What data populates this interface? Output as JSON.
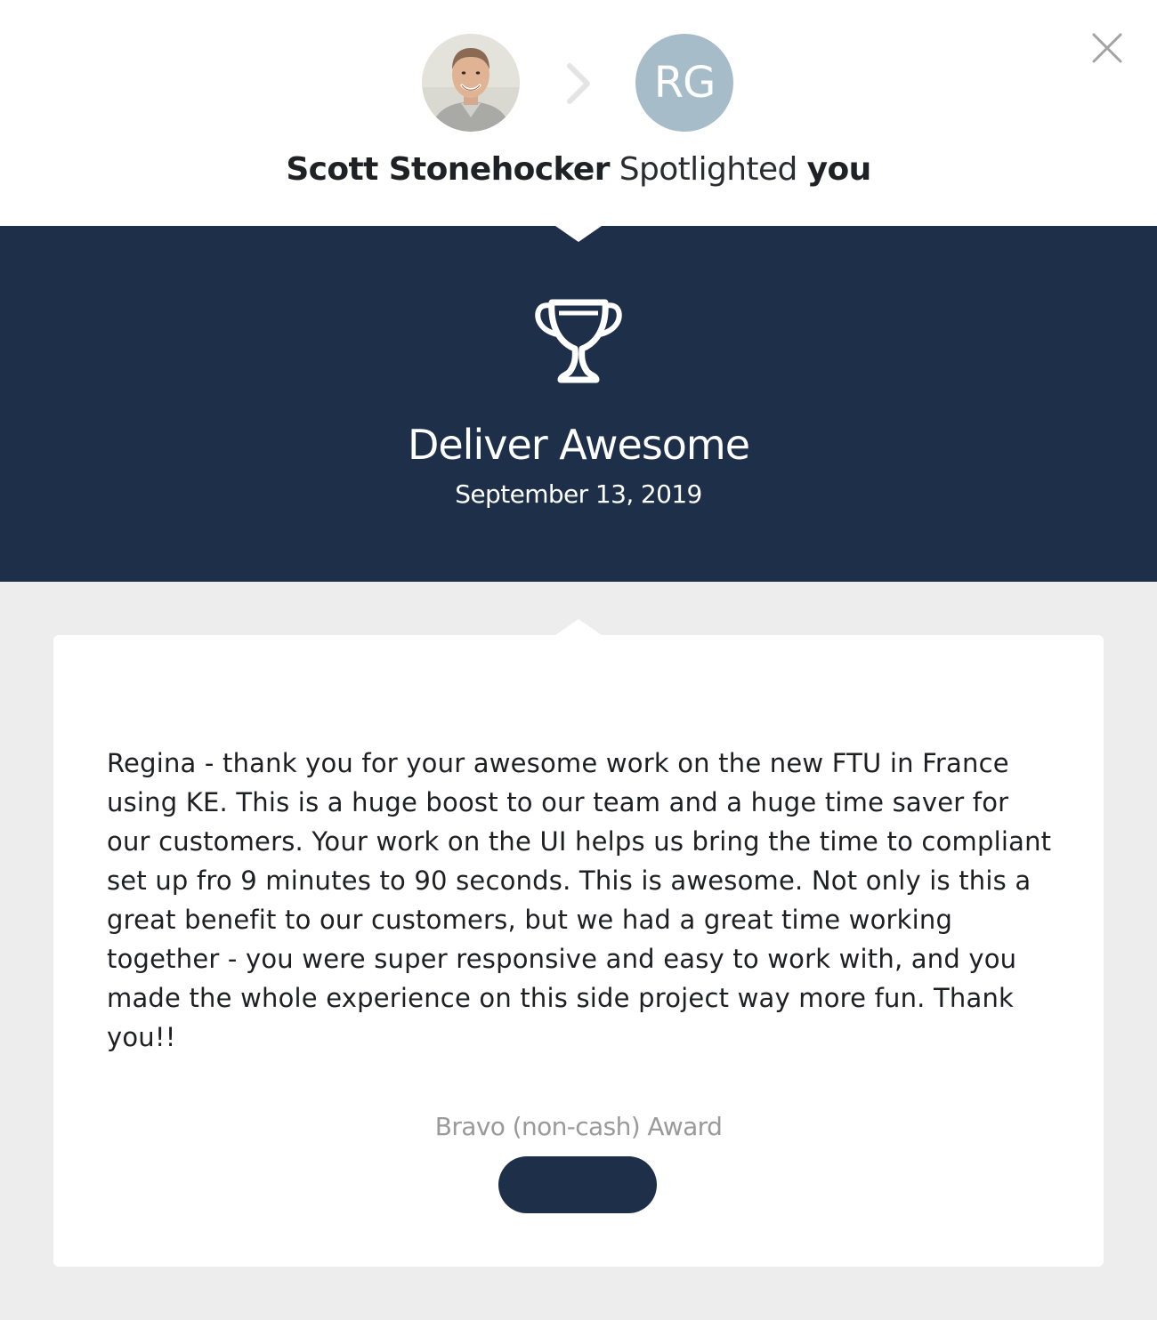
{
  "header": {
    "sender_name": "Scott Stonehocker",
    "action_text": "Spotlighted",
    "recipient_text": "you",
    "recipient_initials": "RG",
    "close_icon": "close-icon",
    "arrow_icon": "chevron-right-icon"
  },
  "banner": {
    "icon": "trophy-icon",
    "title": "Deliver Awesome",
    "date": "September 13, 2019"
  },
  "card": {
    "message": "Regina - thank you for your awesome work on the new FTU in France using KE. This is a huge boost to our team and a huge time saver for our customers. Your work on the UI helps us bring the time to compliant set up fro 9 minutes to 90 seconds. This is awesome. Not only is this a great benefit to our customers, but we had a great time working together - you were super responsive and easy to work with, and you made the whole experience on this side project way more fun. Thank you!!",
    "award_type": "Bravo (non-cash) Award"
  },
  "colors": {
    "navy": "#1d2f49",
    "background": "#ededed",
    "initials_avatar": "#a6bcc9",
    "muted_text": "#9a9a9a"
  }
}
